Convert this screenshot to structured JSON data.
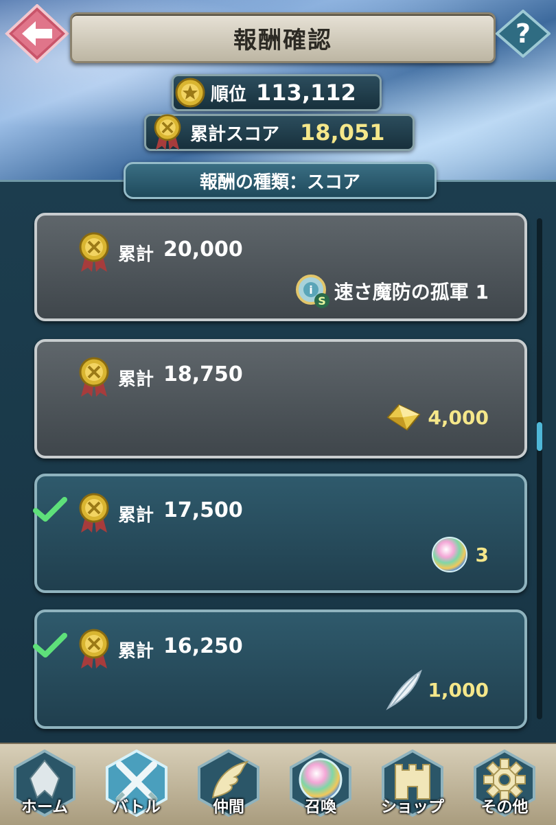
{
  "header": {
    "title": "報酬確認",
    "back_icon": "back-arrow-icon",
    "help_label": "?"
  },
  "stats": {
    "rank_label": "順位",
    "rank_value": "113,112",
    "score_label": "累計スコア",
    "score_value": "18,051"
  },
  "reward_type_tab": "報酬の種類：スコア",
  "rewards": [
    {
      "label": "累計",
      "threshold": "20,000",
      "reward_text": "速さ魔防の孤軍 1",
      "reward_icon": "skill-scroll-icon",
      "claimed": false
    },
    {
      "label": "累計",
      "threshold": "18,750",
      "reward_text": "4,000",
      "reward_icon": "hero-feather-crystal-icon",
      "claimed": false
    },
    {
      "label": "累計",
      "threshold": "17,500",
      "reward_text": "3",
      "reward_icon": "orb-icon",
      "claimed": true
    },
    {
      "label": "累計",
      "threshold": "16,250",
      "reward_text": "1,000",
      "reward_icon": "feather-icon",
      "claimed": true
    }
  ],
  "nav": [
    {
      "label": "ホーム",
      "icon": "home-emblem-icon",
      "active": false
    },
    {
      "label": "バトル",
      "icon": "crossed-swords-icon",
      "active": true
    },
    {
      "label": "仲間",
      "icon": "wing-icon",
      "active": false
    },
    {
      "label": "召喚",
      "icon": "orb-icon",
      "active": false
    },
    {
      "label": "ショップ",
      "icon": "castle-icon",
      "active": false
    },
    {
      "label": "その他",
      "icon": "gear-icon",
      "active": false
    }
  ],
  "colors": {
    "gold_text": "#f5e78a",
    "check_green": "#5ee07a",
    "scroll_thumb": "#4fb8d8"
  }
}
